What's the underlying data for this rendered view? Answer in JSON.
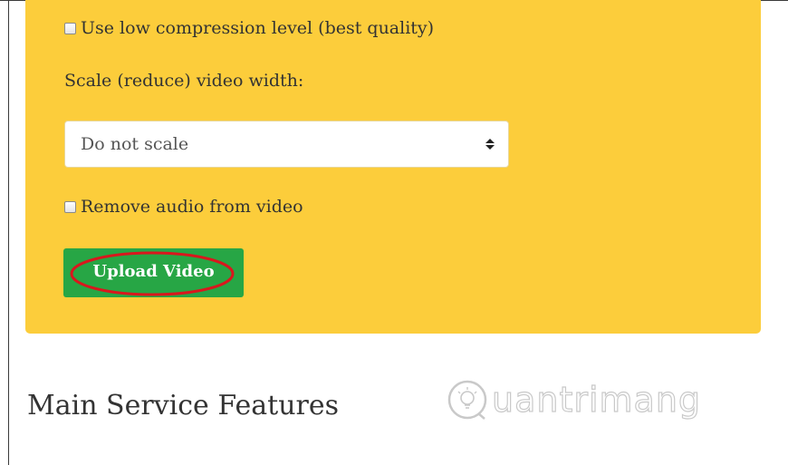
{
  "form": {
    "low_compression_label": "Use low compression level (best quality)",
    "low_compression_checked": false,
    "scale_label": "Scale (reduce) video width:",
    "scale_select": {
      "selected": "Do not scale"
    },
    "remove_audio_label": "Remove audio from video",
    "remove_audio_checked": false,
    "upload_button_label": "Upload Video"
  },
  "section": {
    "title": "Main Service Features"
  },
  "watermark": {
    "text": "uantrimang",
    "icon": "lightbulb-q-icon"
  },
  "colors": {
    "panel_background": "#fccd3b",
    "upload_button": "#27a645",
    "annotation_ellipse": "#d9171d"
  },
  "icons": {
    "select_arrows": "up-down-arrows-icon"
  }
}
